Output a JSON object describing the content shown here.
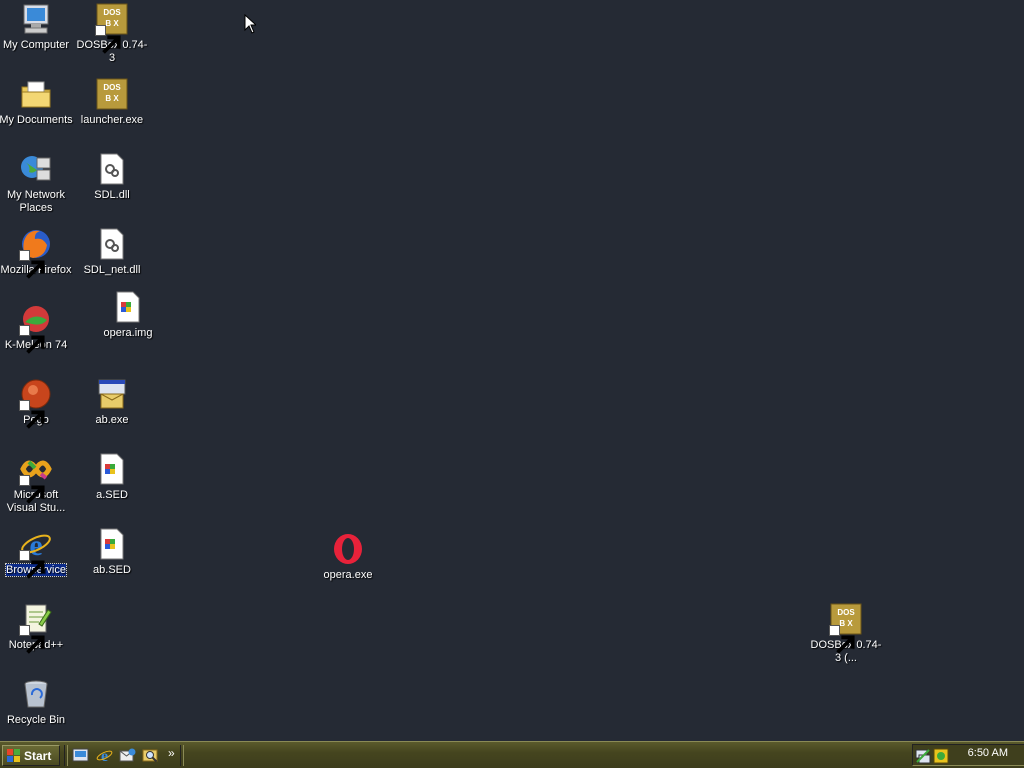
{
  "desktop": {
    "icons": [
      {
        "label": "My Computer",
        "icon": "my-computer-icon"
      },
      {
        "label": "DOSBox 0.74-3",
        "icon": "dosbox-icon"
      },
      {
        "label": "My Documents",
        "icon": "my-documents-icon"
      },
      {
        "label": "launcher.exe",
        "icon": "dosbox-icon"
      },
      {
        "label": "My Network Places",
        "icon": "network-places-icon"
      },
      {
        "label": "SDL.dll",
        "icon": "dll-file-icon"
      },
      {
        "label": "Mozilla Firefox",
        "icon": "firefox-icon"
      },
      {
        "label": "SDL_net.dll",
        "icon": "dll-file-icon"
      },
      {
        "label": "K-Meleon 74",
        "icon": "k-meleon-icon"
      },
      {
        "label": "opera.img",
        "icon": "image-file-icon"
      },
      {
        "label": "Pego",
        "icon": "pego-icon"
      },
      {
        "label": "ab.exe",
        "icon": "exe-installer-icon"
      },
      {
        "label": "Microsoft Visual Stu...",
        "icon": "visual-studio-icon"
      },
      {
        "label": "a.SED",
        "icon": "sed-file-icon"
      },
      {
        "label": "Browservice",
        "icon": "internet-explorer-icon"
      },
      {
        "label": "ab.SED",
        "icon": "sed-file-icon"
      },
      {
        "label": "opera.exe",
        "icon": "opera-icon"
      },
      {
        "label": "Notepad++",
        "icon": "notepadpp-icon"
      },
      {
        "label": "Recycle Bin",
        "icon": "recycle-bin-icon"
      },
      {
        "label": "DOSBox 0.74-3 (...",
        "icon": "dosbox-icon"
      }
    ]
  },
  "taskbar": {
    "start_label": "Start",
    "quicklaunch": [
      "show-desktop-icon",
      "internet-explorer-icon",
      "outlook-express-icon",
      "search-icon"
    ],
    "overflow": "»",
    "clock": "6:50 AM"
  },
  "colors": {
    "desktop": "#252a34",
    "taskbar": "#4a4a22",
    "selection": "#0b2a8a"
  }
}
